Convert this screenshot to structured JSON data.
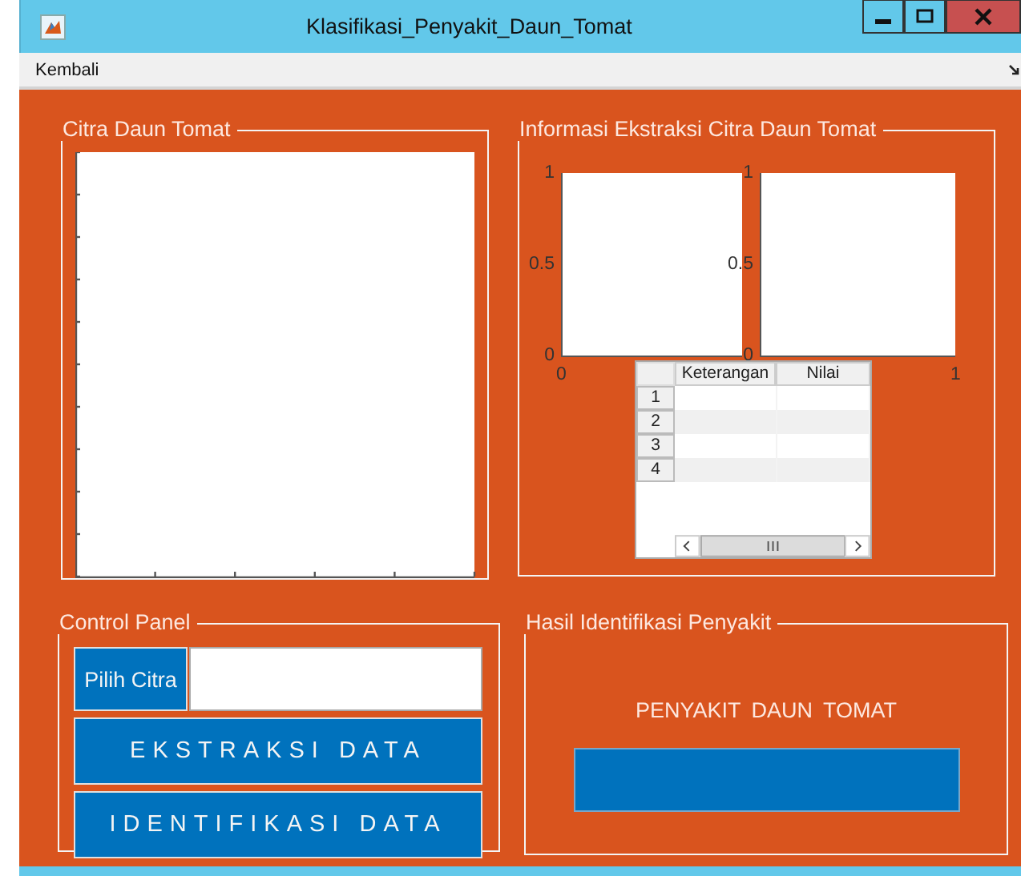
{
  "window": {
    "title": "Klasifikasi_Penyakit_Daun_Tomat"
  },
  "menu": [
    "Kembali"
  ],
  "image_panel": {
    "title": "Citra Daun Tomat"
  },
  "info_panel": {
    "title": "Informasi Ekstraksi Citra Daun Tomat",
    "axes": [
      {
        "yticks": [
          "1",
          "0.5",
          "0"
        ],
        "xticks": [
          "0"
        ]
      },
      {
        "yticks": [
          "1",
          "0.5",
          "0"
        ],
        "xticks": [
          "1"
        ]
      }
    ],
    "table": {
      "columns": [
        "Keterangan",
        "Nilai"
      ],
      "rows": [
        "1",
        "2",
        "3",
        "4"
      ]
    }
  },
  "control_panel": {
    "title": "Control Panel",
    "pick_button": "Pilih Citra",
    "buttons": [
      "EKSTRAKSI DATA",
      "IDENTIFIKASI DATA"
    ]
  },
  "result_panel": {
    "title": "Hasil Identifikasi Penyakit",
    "label": "PENYAKIT DAUN TOMAT"
  }
}
